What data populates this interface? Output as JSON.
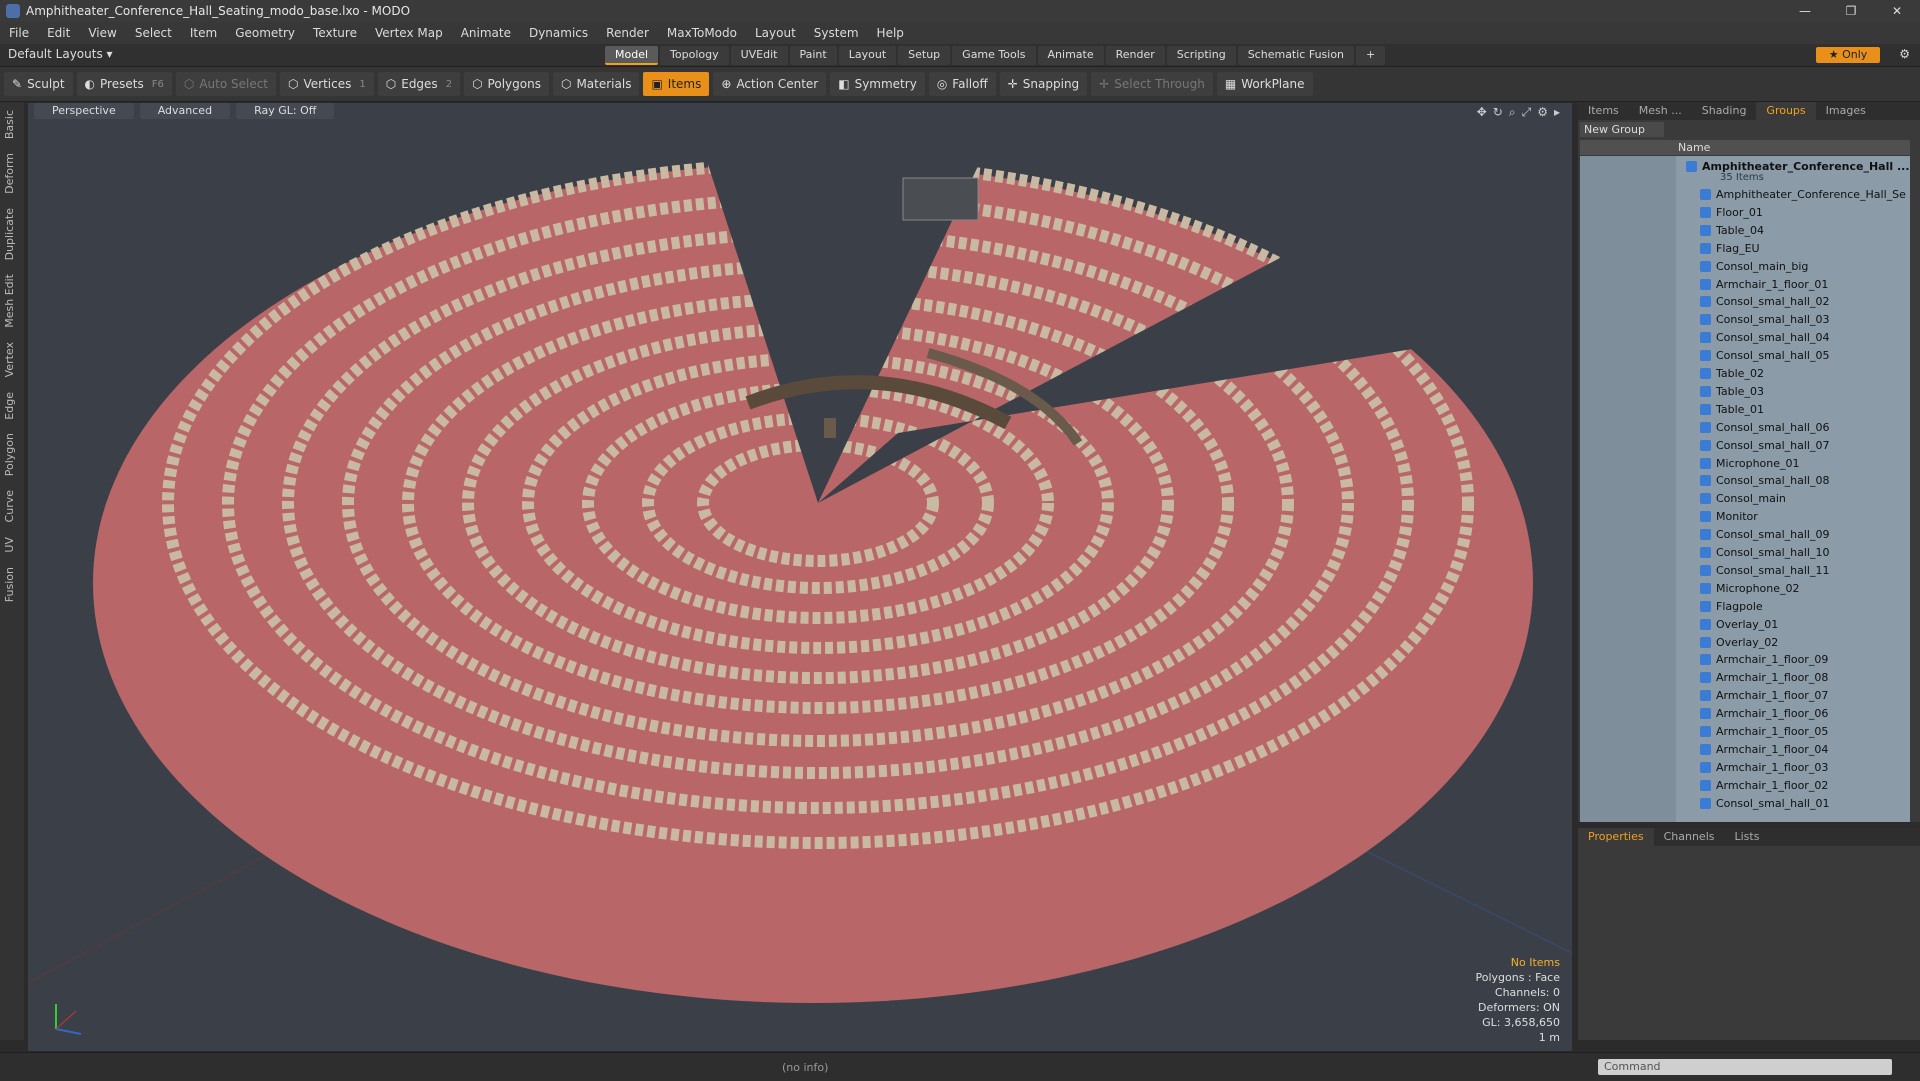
{
  "window": {
    "title": "Amphitheater_Conference_Hall_Seating_modo_base.lxo - MODO",
    "buttons": [
      "—",
      "❐",
      "✕"
    ]
  },
  "menu": [
    "File",
    "Edit",
    "View",
    "Select",
    "Item",
    "Geometry",
    "Texture",
    "Vertex Map",
    "Animate",
    "Dynamics",
    "Render",
    "MaxToModo",
    "Layout",
    "System",
    "Help"
  ],
  "layout": {
    "selector": "Default Layouts ▾",
    "tabs": [
      "Model",
      "Topology",
      "UVEdit",
      "Paint",
      "Layout",
      "Setup",
      "Game Tools",
      "Animate",
      "Render",
      "Scripting",
      "Schematic Fusion"
    ],
    "active_tab": "Model",
    "only_label": "★ Only"
  },
  "toolbar": {
    "sculpt": "Sculpt",
    "presets": "Presets",
    "presets_key": "F6",
    "auto_select": "Auto Select",
    "vertices": "Vertices",
    "vertices_key": "1",
    "edges": "Edges",
    "edges_key": "2",
    "polygons": "Polygons",
    "materials": "Materials",
    "items": "Items",
    "action_center": "Action Center",
    "symmetry": "Symmetry",
    "falloff": "Falloff",
    "snapping": "Snapping",
    "select_through": "Select Through",
    "workplane": "WorkPlane"
  },
  "left_tabs": [
    "Basic",
    "Deform",
    "Duplicate",
    "Mesh Edit",
    "Vertex",
    "Edge",
    "Polygon",
    "Curve",
    "UV",
    "Fusion"
  ],
  "viewport": {
    "view": "Perspective",
    "shading": "Advanced",
    "raygl": "Ray GL: Off",
    "info": {
      "no_items": "No Items",
      "polygons": "Polygons : Face",
      "channels": "Channels: 0",
      "deformers": "Deformers: ON",
      "gl": "GL: 3,658,650",
      "scale": "1 m"
    }
  },
  "right_panel": {
    "tabs": [
      "Items",
      "Mesh ...",
      "Shading",
      "Groups",
      "Images"
    ],
    "active_tab": "Groups",
    "new_group": "New Group",
    "name_header": "Name",
    "root": "Amphitheater_Conference_Hall ...",
    "root_count": "35 Items",
    "items": [
      "Amphitheater_Conference_Hall_Se ...",
      "Floor_01",
      "Table_04",
      "Flag_EU",
      "Consol_main_big",
      "Armchair_1_floor_01",
      "Consol_smal_hall_02",
      "Consol_smal_hall_03",
      "Consol_smal_hall_04",
      "Consol_smal_hall_05",
      "Table_02",
      "Table_03",
      "Table_01",
      "Consol_smal_hall_06",
      "Consol_smal_hall_07",
      "Microphone_01",
      "Consol_smal_hall_08",
      "Consol_main",
      "Monitor",
      "Consol_smal_hall_09",
      "Consol_smal_hall_10",
      "Consol_smal_hall_11",
      "Microphone_02",
      "Flagpole",
      "Overlay_01",
      "Overlay_02",
      "Armchair_1_floor_09",
      "Armchair_1_floor_08",
      "Armchair_1_floor_07",
      "Armchair_1_floor_06",
      "Armchair_1_floor_05",
      "Armchair_1_floor_04",
      "Armchair_1_floor_03",
      "Armchair_1_floor_02",
      "Consol_smal_hall_01"
    ]
  },
  "bottom_panel": {
    "tabs": [
      "Properties",
      "Channels",
      "Lists"
    ],
    "active_tab": "Properties"
  },
  "status": {
    "info": "(no info)",
    "command_placeholder": "Command"
  }
}
